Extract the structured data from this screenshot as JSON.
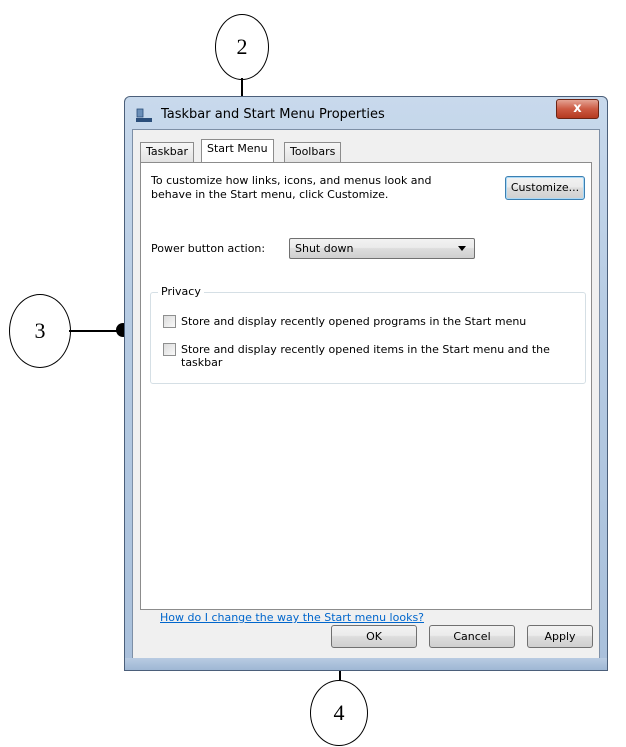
{
  "window": {
    "title": "Taskbar and Start Menu Properties",
    "close_label": "x"
  },
  "tabs": [
    {
      "label": "Taskbar"
    },
    {
      "label": "Start Menu"
    },
    {
      "label": "Toolbars"
    }
  ],
  "start_menu": {
    "description": "To customize how links, icons, and menus look and behave in the Start menu, click Customize.",
    "customize_label": "Customize...",
    "power_button_label": "Power button action:",
    "power_button_value": "Shut down",
    "privacy": {
      "title": "Privacy",
      "options": [
        {
          "label": "Store and display recently opened programs in the Start menu",
          "checked": false
        },
        {
          "label": "Store and display recently opened items in the Start menu and the taskbar",
          "checked": false
        }
      ]
    },
    "help_link": "How do I change the way the Start menu looks?"
  },
  "buttons": {
    "ok": "OK",
    "cancel": "Cancel",
    "apply": "Apply"
  },
  "callouts": {
    "c2": "2",
    "c3": "3",
    "c4": "4"
  }
}
